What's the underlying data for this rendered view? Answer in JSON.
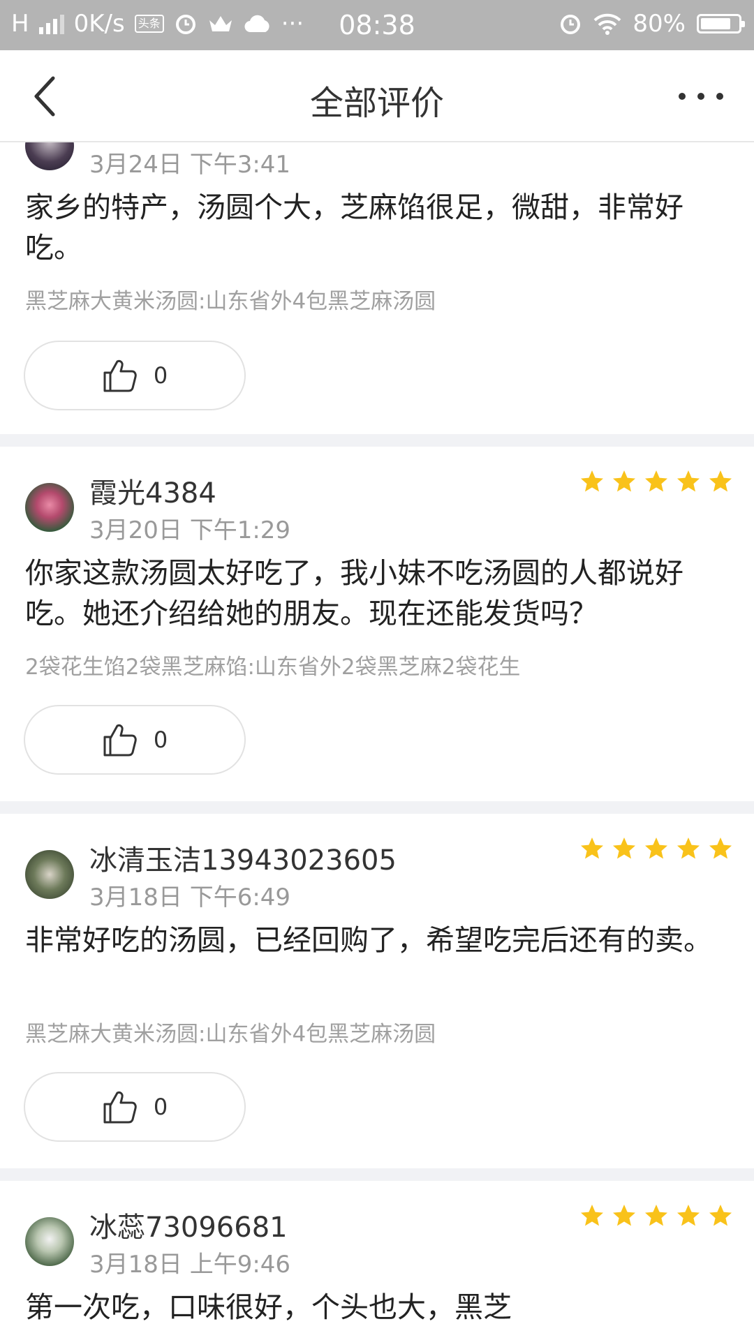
{
  "status_bar": {
    "network": "H",
    "speed": "0K/s",
    "toutiao_badge": "头条",
    "more": "···",
    "time": "08:38",
    "battery_text": "80%",
    "battery_level": 0.8
  },
  "nav": {
    "title": "全部评价"
  },
  "reviews": [
    {
      "user": "",
      "date": "3月24日 下午3:41",
      "stars": 0,
      "text": "家乡的特产，汤圆个大，芝麻馅很足，微甜，非常好吃。",
      "sku": "黑芝麻大黄米汤圆:山东省外4包黑芝麻汤圆",
      "likes": "0"
    },
    {
      "user": "霞光4384",
      "date": "3月20日 下午1:29",
      "stars": 5,
      "text": "你家这款汤圆太好吃了，我小妹不吃汤圆的人都说好吃。她还介绍给她的朋友。现在还能发货吗？",
      "sku": "2袋花生馅2袋黑芝麻馅:山东省外2袋黑芝麻2袋花生",
      "likes": "0"
    },
    {
      "user": "冰清玉洁13943023605",
      "date": "3月18日 下午6:49",
      "stars": 5,
      "text": "非常好吃的汤圆，已经回购了，希望吃完后还有的卖。",
      "sku": "黑芝麻大黄米汤圆:山东省外4包黑芝麻汤圆",
      "likes": "0"
    },
    {
      "user": "冰蕊73096681",
      "date": "3月18日 上午9:46",
      "stars": 5,
      "text": "第一次吃，口味很好，个头也大，黑芝",
      "sku": "",
      "likes": ""
    }
  ],
  "colors": {
    "status_bar_bg": "#b4b4b4",
    "star": "#f9c21a",
    "separator": "#f1f2f5",
    "meta_text": "#999999"
  },
  "icons": {
    "back": "chevron-left-icon",
    "more": "more-dots-icon",
    "like": "thumbs-up-icon",
    "star": "star-icon"
  }
}
